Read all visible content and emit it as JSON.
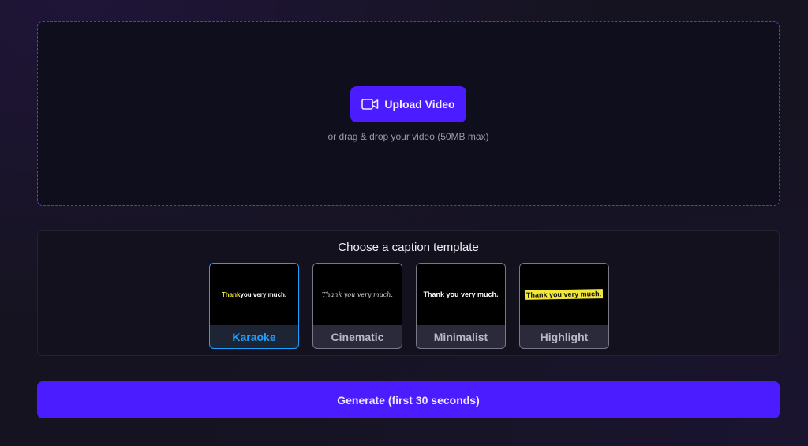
{
  "upload": {
    "button_label": "Upload Video",
    "icon": "video-camera-icon",
    "hint": "or drag & drop your video (50MB max)"
  },
  "templates": {
    "title": "Choose a caption template",
    "selected": "Karaoke",
    "items": [
      {
        "label": "Karaoke",
        "preview_highlight": "Thank",
        "preview_rest": " you very much."
      },
      {
        "label": "Cinematic",
        "preview": "Thank you very much."
      },
      {
        "label": "Minimalist",
        "preview": "Thank you very much."
      },
      {
        "label": "Highlight",
        "preview": "Thank you very much."
      }
    ]
  },
  "generate": {
    "label": "Generate (first 30 seconds)"
  },
  "colors": {
    "accent": "#4b1cff",
    "selected": "#1aa0ff",
    "dropzone_border": "#6a2fd6",
    "highlight_yellow": "#f2e83a"
  }
}
